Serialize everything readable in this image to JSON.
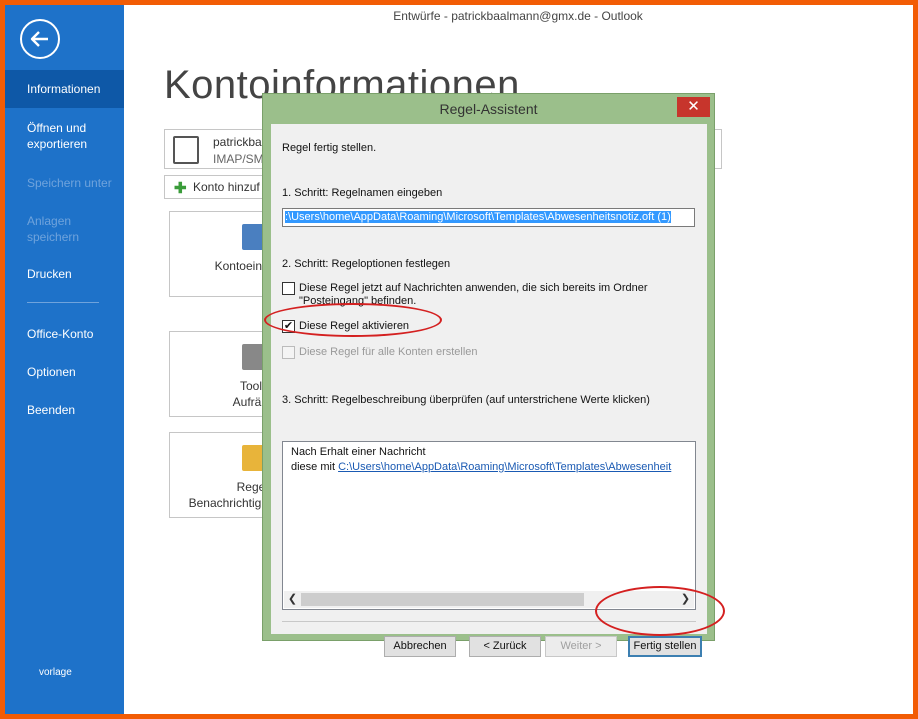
{
  "window": {
    "title": "Entwürfe - patrickbaalmann@gmx.de - Outlook"
  },
  "sidebar": {
    "items": [
      {
        "label": "Informationen",
        "state": "active"
      },
      {
        "label": "Öffnen und",
        "label2": "exportieren",
        "state": "normal"
      },
      {
        "label": "Speichern unter",
        "state": "disabled"
      },
      {
        "label": "Anlagen",
        "label2": "speichern",
        "state": "disabled"
      },
      {
        "label": "Drucken",
        "state": "normal"
      },
      {
        "label": "Office-Konto",
        "state": "normal"
      },
      {
        "label": "Optionen",
        "state": "normal"
      },
      {
        "label": "Beenden",
        "state": "normal"
      }
    ],
    "footer": "vorlage"
  },
  "main": {
    "page_title": "Kontoinformationen",
    "account": {
      "name": "patrickba",
      "type": "IMAP/SM"
    },
    "add_account": "Konto hinzuf",
    "tiles": [
      {
        "line1": "Kontoeins",
        "line2": ""
      },
      {
        "line1": "Tools",
        "line2": "Aufräu"
      },
      {
        "line1": "Regel",
        "line2": "Benachrichtigu"
      }
    ]
  },
  "dialog": {
    "title": "Regel-Assistent",
    "close": "✕",
    "heading": "Regel fertig stellen.",
    "step1": "1. Schritt: Regelnamen eingeben",
    "rule_name": ":\\Users\\home\\AppData\\Roaming\\Microsoft\\Templates\\Abwesenheitsnotiz.oft (1)",
    "step2": "2. Schritt: Regeloptionen festlegen",
    "options": [
      {
        "label": "Diese Regel jetzt auf Nachrichten anwenden, die sich bereits im Ordner",
        "label2": "\"Posteingang\" befinden.",
        "checked": false,
        "enabled": true
      },
      {
        "label": "Diese Regel aktivieren",
        "checked": true,
        "enabled": true
      },
      {
        "label": "Diese Regel für alle Konten erstellen",
        "checked": false,
        "enabled": false
      }
    ],
    "step3": "3. Schritt: Regelbeschreibung überprüfen (auf unterstrichene Werte klicken)",
    "description": {
      "line1": "Nach Erhalt einer Nachricht",
      "line2_prefix": "diese mit ",
      "line2_link": "C:\\Users\\home\\AppData\\Roaming\\Microsoft\\Templates\\Abwesenheit"
    },
    "buttons": {
      "cancel": "Abbrechen",
      "back": "< Zurück",
      "next": "Weiter >",
      "finish": "Fertig stellen"
    }
  },
  "colors": {
    "frame": "#f25c05",
    "sidebar": "#1e72c9",
    "dialog_border": "#9bbf8b",
    "annotation": "#d42020"
  }
}
